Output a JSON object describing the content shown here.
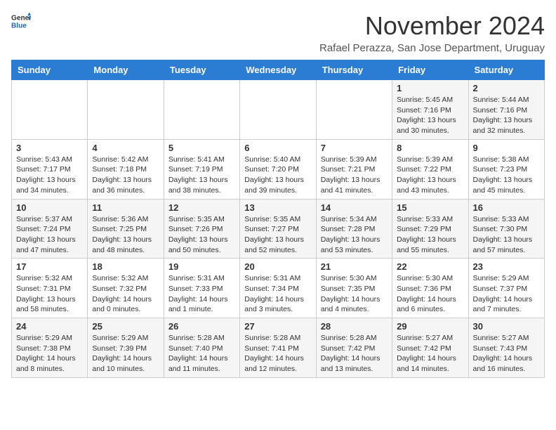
{
  "header": {
    "logo_line1": "General",
    "logo_line2": "Blue",
    "month_title": "November 2024",
    "subtitle": "Rafael Perazza, San Jose Department, Uruguay"
  },
  "weekdays": [
    "Sunday",
    "Monday",
    "Tuesday",
    "Wednesday",
    "Thursday",
    "Friday",
    "Saturday"
  ],
  "weeks": [
    [
      {
        "day": "",
        "info": ""
      },
      {
        "day": "",
        "info": ""
      },
      {
        "day": "",
        "info": ""
      },
      {
        "day": "",
        "info": ""
      },
      {
        "day": "",
        "info": ""
      },
      {
        "day": "1",
        "info": "Sunrise: 5:45 AM\nSunset: 7:16 PM\nDaylight: 13 hours and 30 minutes."
      },
      {
        "day": "2",
        "info": "Sunrise: 5:44 AM\nSunset: 7:16 PM\nDaylight: 13 hours and 32 minutes."
      }
    ],
    [
      {
        "day": "3",
        "info": "Sunrise: 5:43 AM\nSunset: 7:17 PM\nDaylight: 13 hours and 34 minutes."
      },
      {
        "day": "4",
        "info": "Sunrise: 5:42 AM\nSunset: 7:18 PM\nDaylight: 13 hours and 36 minutes."
      },
      {
        "day": "5",
        "info": "Sunrise: 5:41 AM\nSunset: 7:19 PM\nDaylight: 13 hours and 38 minutes."
      },
      {
        "day": "6",
        "info": "Sunrise: 5:40 AM\nSunset: 7:20 PM\nDaylight: 13 hours and 39 minutes."
      },
      {
        "day": "7",
        "info": "Sunrise: 5:39 AM\nSunset: 7:21 PM\nDaylight: 13 hours and 41 minutes."
      },
      {
        "day": "8",
        "info": "Sunrise: 5:39 AM\nSunset: 7:22 PM\nDaylight: 13 hours and 43 minutes."
      },
      {
        "day": "9",
        "info": "Sunrise: 5:38 AM\nSunset: 7:23 PM\nDaylight: 13 hours and 45 minutes."
      }
    ],
    [
      {
        "day": "10",
        "info": "Sunrise: 5:37 AM\nSunset: 7:24 PM\nDaylight: 13 hours and 47 minutes."
      },
      {
        "day": "11",
        "info": "Sunrise: 5:36 AM\nSunset: 7:25 PM\nDaylight: 13 hours and 48 minutes."
      },
      {
        "day": "12",
        "info": "Sunrise: 5:35 AM\nSunset: 7:26 PM\nDaylight: 13 hours and 50 minutes."
      },
      {
        "day": "13",
        "info": "Sunrise: 5:35 AM\nSunset: 7:27 PM\nDaylight: 13 hours and 52 minutes."
      },
      {
        "day": "14",
        "info": "Sunrise: 5:34 AM\nSunset: 7:28 PM\nDaylight: 13 hours and 53 minutes."
      },
      {
        "day": "15",
        "info": "Sunrise: 5:33 AM\nSunset: 7:29 PM\nDaylight: 13 hours and 55 minutes."
      },
      {
        "day": "16",
        "info": "Sunrise: 5:33 AM\nSunset: 7:30 PM\nDaylight: 13 hours and 57 minutes."
      }
    ],
    [
      {
        "day": "17",
        "info": "Sunrise: 5:32 AM\nSunset: 7:31 PM\nDaylight: 13 hours and 58 minutes."
      },
      {
        "day": "18",
        "info": "Sunrise: 5:32 AM\nSunset: 7:32 PM\nDaylight: 14 hours and 0 minutes."
      },
      {
        "day": "19",
        "info": "Sunrise: 5:31 AM\nSunset: 7:33 PM\nDaylight: 14 hours and 1 minute."
      },
      {
        "day": "20",
        "info": "Sunrise: 5:31 AM\nSunset: 7:34 PM\nDaylight: 14 hours and 3 minutes."
      },
      {
        "day": "21",
        "info": "Sunrise: 5:30 AM\nSunset: 7:35 PM\nDaylight: 14 hours and 4 minutes."
      },
      {
        "day": "22",
        "info": "Sunrise: 5:30 AM\nSunset: 7:36 PM\nDaylight: 14 hours and 6 minutes."
      },
      {
        "day": "23",
        "info": "Sunrise: 5:29 AM\nSunset: 7:37 PM\nDaylight: 14 hours and 7 minutes."
      }
    ],
    [
      {
        "day": "24",
        "info": "Sunrise: 5:29 AM\nSunset: 7:38 PM\nDaylight: 14 hours and 8 minutes."
      },
      {
        "day": "25",
        "info": "Sunrise: 5:29 AM\nSunset: 7:39 PM\nDaylight: 14 hours and 10 minutes."
      },
      {
        "day": "26",
        "info": "Sunrise: 5:28 AM\nSunset: 7:40 PM\nDaylight: 14 hours and 11 minutes."
      },
      {
        "day": "27",
        "info": "Sunrise: 5:28 AM\nSunset: 7:41 PM\nDaylight: 14 hours and 12 minutes."
      },
      {
        "day": "28",
        "info": "Sunrise: 5:28 AM\nSunset: 7:42 PM\nDaylight: 14 hours and 13 minutes."
      },
      {
        "day": "29",
        "info": "Sunrise: 5:27 AM\nSunset: 7:42 PM\nDaylight: 14 hours and 14 minutes."
      },
      {
        "day": "30",
        "info": "Sunrise: 5:27 AM\nSunset: 7:43 PM\nDaylight: 14 hours and 16 minutes."
      }
    ]
  ]
}
